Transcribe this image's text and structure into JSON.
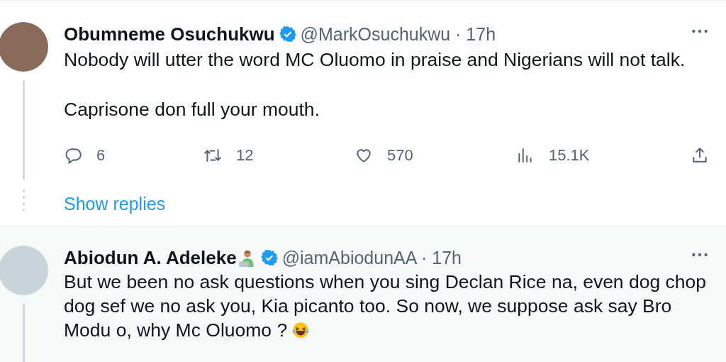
{
  "tweets": [
    {
      "author": {
        "name": "Obumneme Osuchukwu",
        "verified": true,
        "meta": "@MarkOsuchukwu · 17h"
      },
      "paragraphs": [
        "Nobody will utter the word MC Oluomo in praise and Nigerians will not talk.",
        "Caprisone don full your mouth."
      ],
      "stats": {
        "replies": "6",
        "reposts": "12",
        "likes": "570",
        "views": "15.1K"
      },
      "show_replies": "Show replies",
      "highlighted": false
    },
    {
      "author": {
        "name": "Abiodun A. Adeleke",
        "verified": true,
        "meta": "@iamAbiodunAA · 17h",
        "name_emojis": [
          {
            "kind": "technologist"
          }
        ]
      },
      "paragraphs": [
        "But we been no ask questions when you sing Declan Rice na, even dog chop dog sef we no ask you, Kia picanto too. So now, we suppose ask say Bro Modu o, why Mc Oluomo ?"
      ],
      "trailing_emojis": [
        {
          "kind": "laughing"
        }
      ],
      "highlighted": true
    }
  ]
}
